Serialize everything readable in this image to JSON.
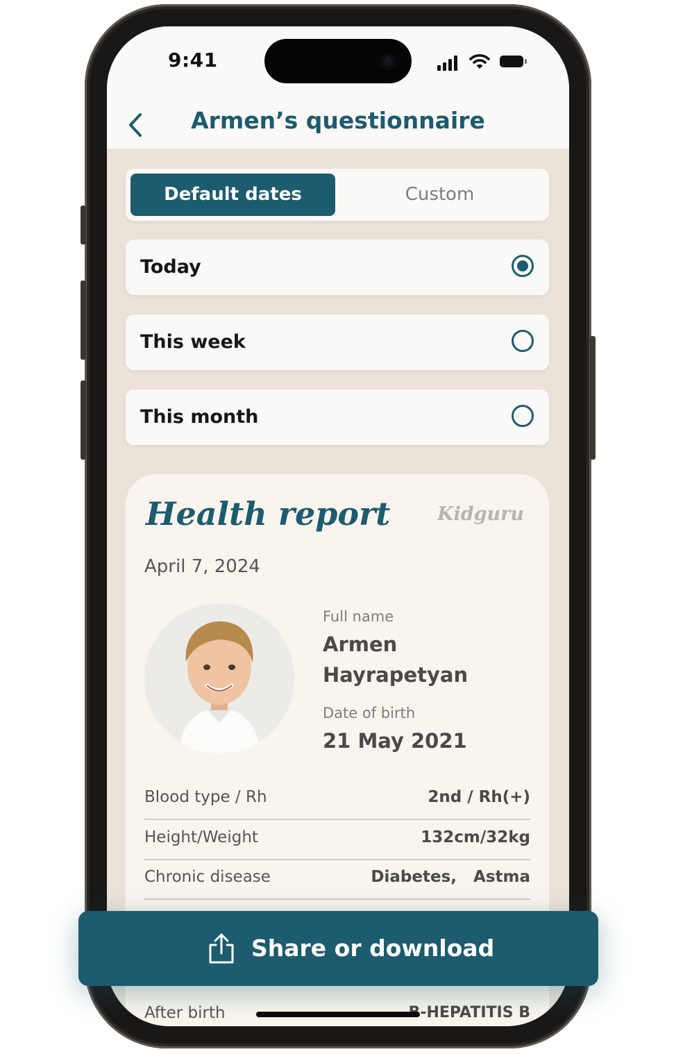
{
  "status_bar": {
    "time": "9:41"
  },
  "header": {
    "title": "Armen’s questionnaire"
  },
  "segmented": {
    "default_label": "Default dates",
    "custom_label": "Custom",
    "selected": "Default dates"
  },
  "options": [
    {
      "label": "Today",
      "selected": true
    },
    {
      "label": "This week",
      "selected": false
    },
    {
      "label": "This month",
      "selected": false
    }
  ],
  "report": {
    "title": "Health report",
    "logo": "Kidguru",
    "date": "April 7, 2024",
    "full_name_label": "Full name",
    "full_name_first": "Armen",
    "full_name_last": "Hayrapetyan",
    "dob_label": "Date of birth",
    "dob_value": "21 May 2021",
    "rows": [
      {
        "key": "Blood type / Rh",
        "value": "2nd / Rh(+)"
      },
      {
        "key": "Height/Weight",
        "value": "132cm/32kg"
      },
      {
        "key": "Chronic disease",
        "value": "Diabetes,   Astma"
      }
    ],
    "after_birth_label": "After birth",
    "after_birth_value": "B-HEPATITIS B"
  },
  "share_button": {
    "label": "Share or download"
  },
  "colors": {
    "accent": "#1d5b6e",
    "background": "#ebe3d9",
    "card": "#faf9f7",
    "report_card": "#f9f5ee"
  }
}
